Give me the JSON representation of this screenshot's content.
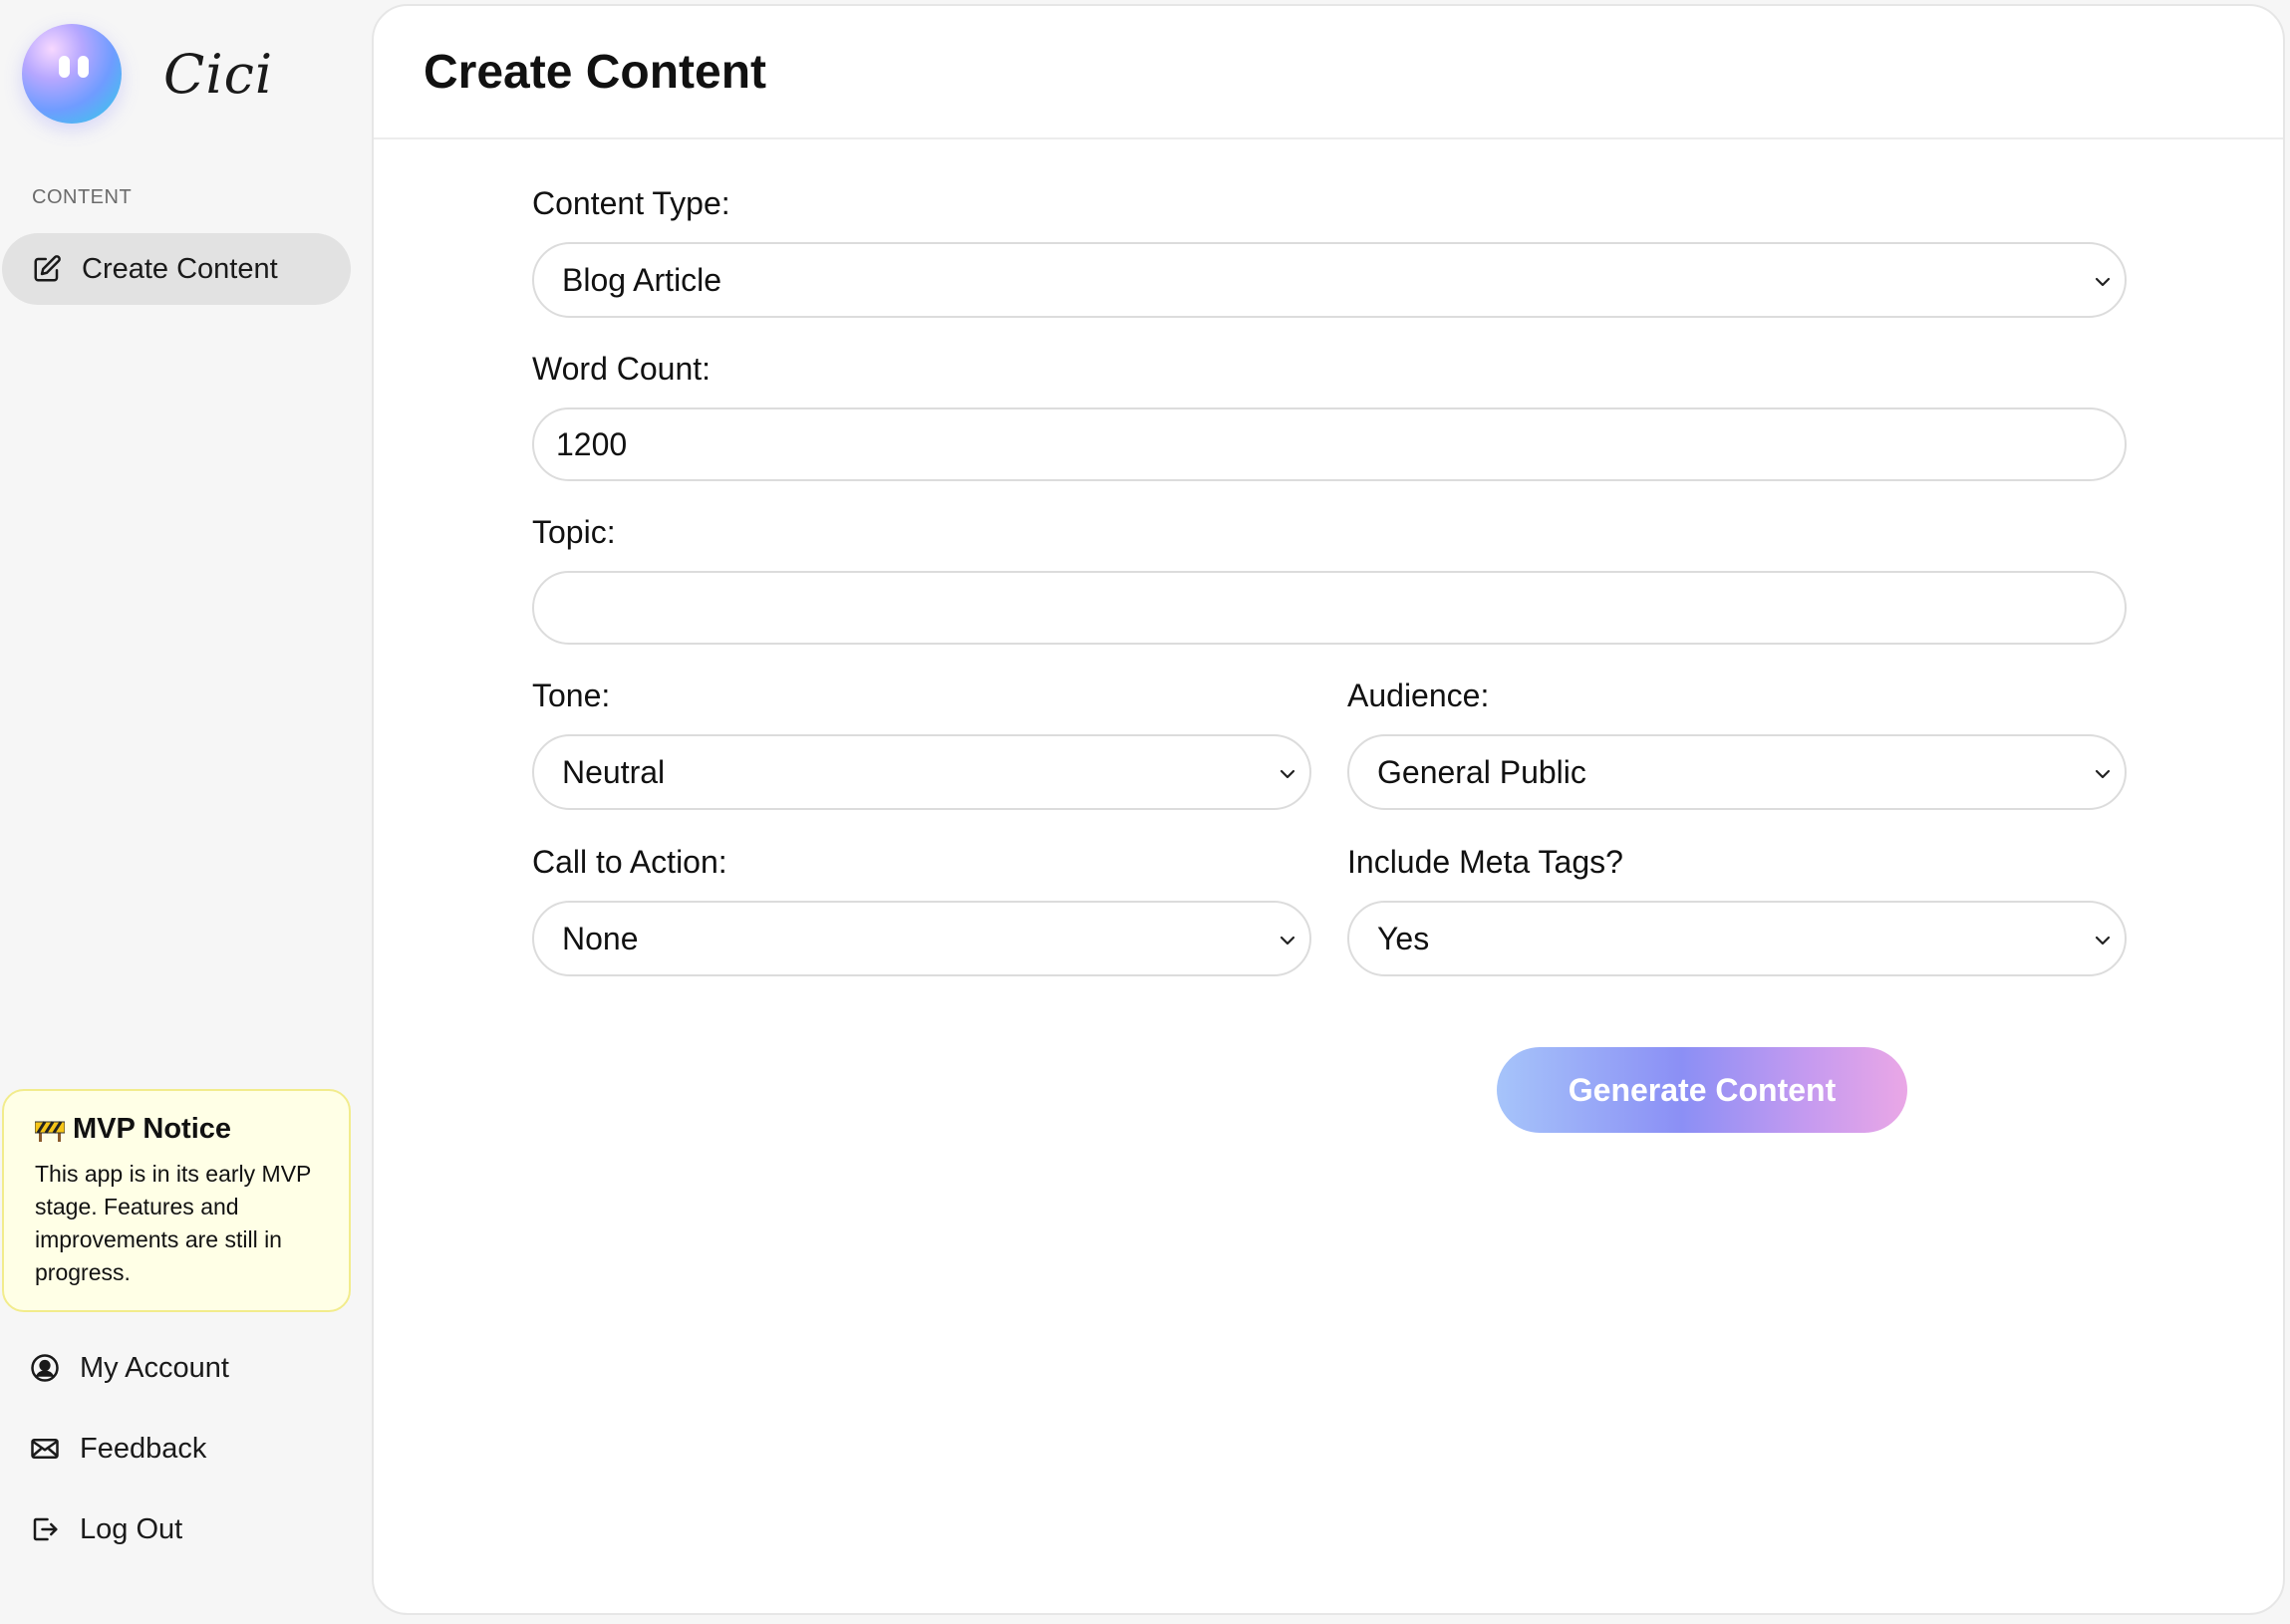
{
  "app": {
    "name": "Cici"
  },
  "sidebar": {
    "section_label": "CONTENT",
    "items": [
      {
        "label": "Create Content",
        "icon": "edit-icon",
        "active": true
      }
    ],
    "notice": {
      "title": "MVP Notice",
      "icon": "construction-barrier-icon",
      "body": "This app is in its early MVP stage. Features and improvements are still in progress."
    },
    "bottom_items": [
      {
        "label": "My Account",
        "icon": "user-circle-icon"
      },
      {
        "label": "Feedback",
        "icon": "mail-icon"
      },
      {
        "label": "Log Out",
        "icon": "logout-icon"
      }
    ]
  },
  "main": {
    "title": "Create Content",
    "form": {
      "content_type": {
        "label": "Content Type:",
        "value": "Blog Article"
      },
      "word_count": {
        "label": "Word Count:",
        "value": "1200"
      },
      "topic": {
        "label": "Topic:",
        "value": ""
      },
      "tone": {
        "label": "Tone:",
        "value": "Neutral"
      },
      "audience": {
        "label": "Audience:",
        "value": "General Public"
      },
      "call_to_action": {
        "label": "Call to Action:",
        "value": "None"
      },
      "meta_tags": {
        "label": "Include Meta Tags?",
        "value": "Yes"
      }
    },
    "generate_button": {
      "label": "Generate Content"
    }
  },
  "colors": {
    "sidebar_bg": "#f6f6f6",
    "active_item_bg": "#e2e2e2",
    "notice_bg": "#ffffe6",
    "notice_border": "#f2ec8c",
    "button_gradient_start": "#a6c4fa",
    "button_gradient_end": "#eaa7e6"
  }
}
